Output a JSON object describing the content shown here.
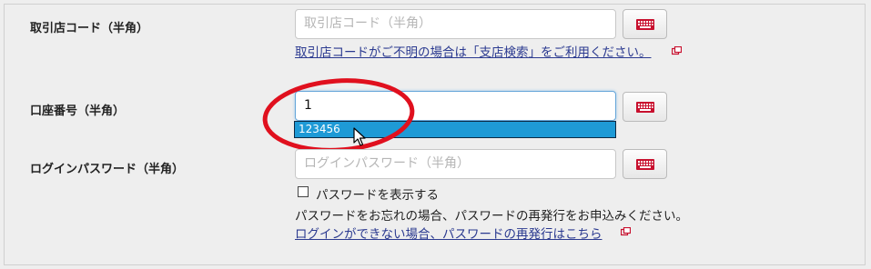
{
  "fields": {
    "branch": {
      "label": "取引店コード（半角）",
      "placeholder": "取引店コード（半角）",
      "help_link": "取引店コードがご不明の場合は「支店検索」をご利用ください。"
    },
    "account": {
      "label": "口座番号（半角）",
      "value": "1",
      "suggestion": "123456"
    },
    "password": {
      "label": "ログインパスワード（半角）",
      "placeholder": "ログインパスワード（半角）",
      "show_password_label": "パスワードを表示する",
      "forgot_text": "パスワードをお忘れの場合、パスワードの再発行をお申込みください。",
      "help_link": "ログインができない場合、パスワードの再発行はこちら"
    }
  },
  "icons": {
    "keyboard": "software-keyboard-icon",
    "external": "external-window-icon"
  },
  "colors": {
    "keyboard_red": "#c8102e",
    "link": "#2b3a90",
    "highlight": "#1e9ad6",
    "annotation": "#e0101e"
  }
}
